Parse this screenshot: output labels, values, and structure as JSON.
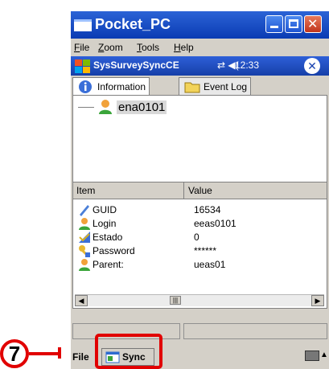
{
  "window": {
    "title": "Pocket_PC",
    "icons": {
      "minimize": "minimize-icon",
      "maximize": "maximize-icon",
      "close": "close-icon"
    }
  },
  "menu": {
    "items": [
      "File",
      "Zoom",
      "Tools",
      "Help"
    ]
  },
  "device_title": {
    "app_name": "SysSurveySyncCE",
    "signal": "⇄ ◀(",
    "time": "12:33",
    "ok_glyph": "✕"
  },
  "tabs": [
    {
      "label": "Information",
      "icon": "info-icon",
      "active": true
    },
    {
      "label": "Event Log",
      "icon": "folder-icon",
      "active": false
    }
  ],
  "tree": {
    "node_label": "ena0101",
    "icon": "user-icon"
  },
  "list": {
    "headers": {
      "item": "Item",
      "value": "Value"
    },
    "rows": [
      {
        "key": "GUID",
        "value": "16534",
        "icon": "pen-icon"
      },
      {
        "key": "Login",
        "value": "eeas0101",
        "icon": "user-icon"
      },
      {
        "key": "Estado",
        "value": "0",
        "icon": "check-icon"
      },
      {
        "key": "Password",
        "value": "******",
        "icon": "key-icon"
      },
      {
        "key": "Parent:",
        "value": "ueas01",
        "icon": "user-icon"
      }
    ],
    "scroll": {
      "left_glyph": "◀",
      "right_glyph": "▶",
      "thumb_glyph": "|||"
    }
  },
  "cmdbar": {
    "file_label": "File",
    "sync_label": "Sync",
    "sync_icon": "sync-icon",
    "keyboard_icon": "keyboard-icon",
    "sip_arrow": "▲"
  },
  "annotation": {
    "marker": "7",
    "color": "#e10000"
  },
  "colors": {
    "titlebar": "#2c63d6",
    "accent": "#1a43b0",
    "highlight": "#e10000"
  }
}
